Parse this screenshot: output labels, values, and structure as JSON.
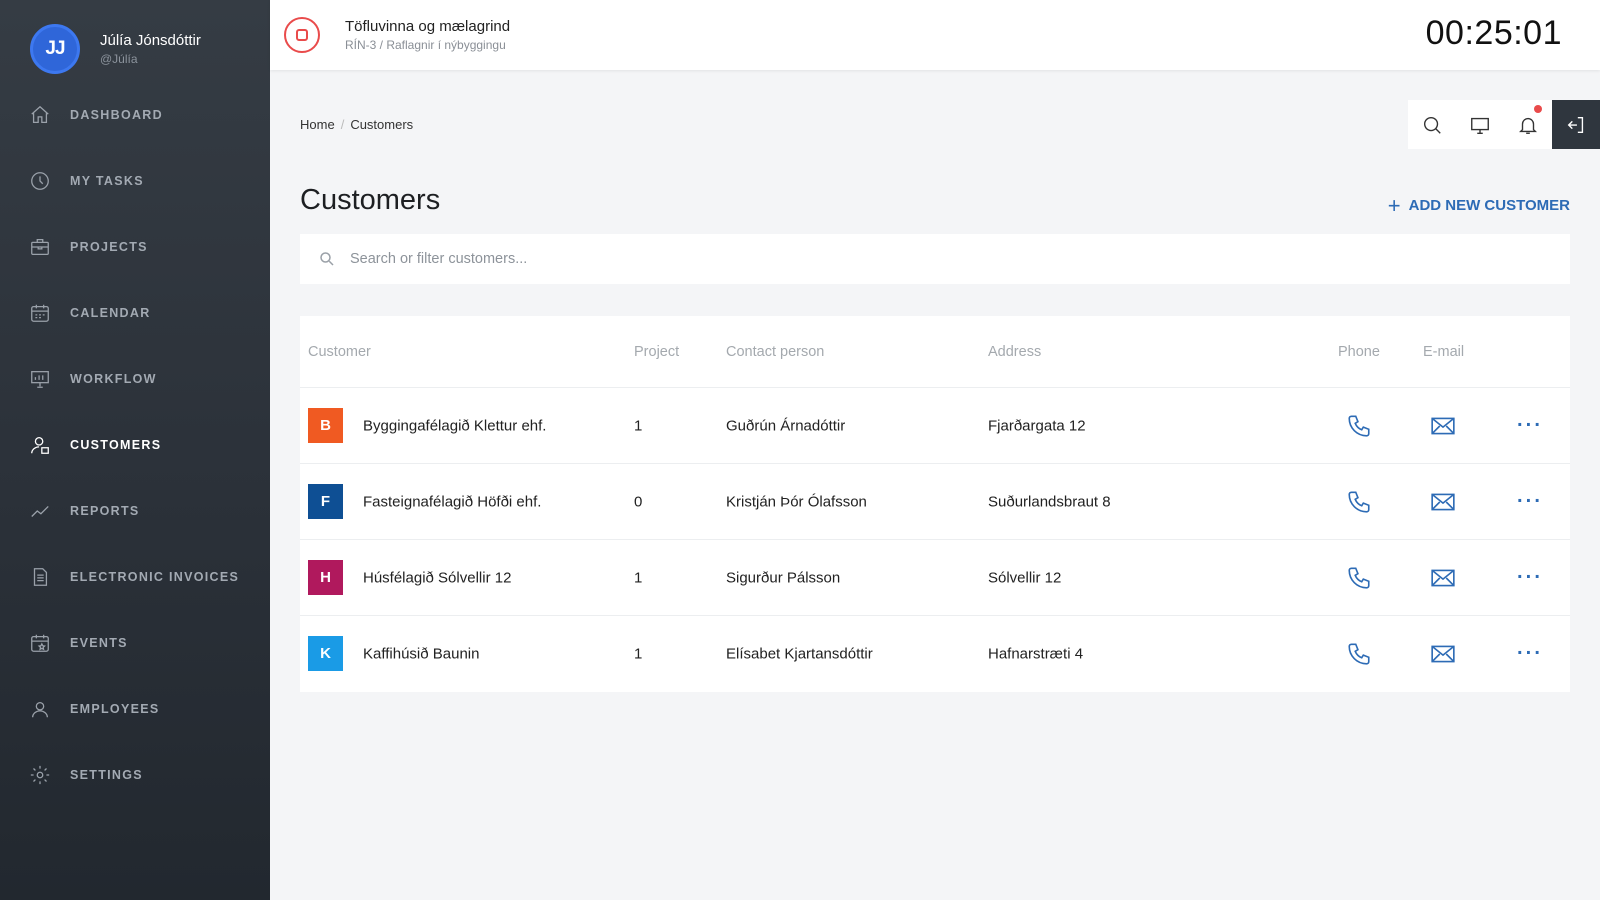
{
  "user": {
    "initials": "JJ",
    "name": "Júlía Jónsdóttir",
    "handle": "@Júlía"
  },
  "nav": [
    {
      "label": "DASHBOARD",
      "icon": "home-icon"
    },
    {
      "label": "MY TASKS",
      "icon": "clock-icon"
    },
    {
      "label": "PROJECTS",
      "icon": "briefcase-icon"
    },
    {
      "label": "CALENDAR",
      "icon": "calendar-icon"
    },
    {
      "label": "WORKFLOW",
      "icon": "presentation-chart-icon"
    },
    {
      "label": "CUSTOMERS",
      "icon": "user-icon",
      "active": true
    },
    {
      "label": "REPORTS",
      "icon": "trend-line-icon"
    },
    {
      "label": "ELECTRONIC INVOICES",
      "icon": "document-icon"
    },
    {
      "label": "EVENTS",
      "icon": "calendar-star-icon"
    },
    {
      "label": "EMPLOYEES",
      "icon": "users-icon"
    },
    {
      "label": "SETTINGS",
      "icon": "gear-icon"
    }
  ],
  "timer": {
    "task_title": "Töfluvinna og mælagrind",
    "task_sub": "RÍN-3 / Raflagnir í nýbyggingu",
    "elapsed": "00:25:01"
  },
  "breadcrumb": {
    "home": "Home",
    "current": "Customers"
  },
  "page": {
    "title": "Customers",
    "add_label": "ADD NEW CUSTOMER",
    "add_icon": "plus-icon"
  },
  "search": {
    "placeholder": "Search or filter customers..."
  },
  "table": {
    "headers": {
      "customer": "Customer",
      "project": "Project",
      "contact": "Contact person",
      "address": "Address",
      "phone": "Phone",
      "email": "E-mail"
    },
    "rows": [
      {
        "initial": "B",
        "color": "#f05a22",
        "name": "Byggingafélagið Klettur ehf.",
        "project": "1",
        "contact": "Guðrún Árnadóttir",
        "address": "Fjarðargata 12"
      },
      {
        "initial": "F",
        "color": "#0e4f94",
        "name": "Fasteignafélagið Höfði ehf.",
        "project": "0",
        "contact": "Kristján Þór Ólafsson",
        "address": "Suðurlandsbraut 8"
      },
      {
        "initial": "H",
        "color": "#b0195d",
        "name": "Húsfélagið Sólvellir 12",
        "project": "1",
        "contact": "Sigurður Pálsson",
        "address": "Sólvellir 12"
      },
      {
        "initial": "K",
        "color": "#1a9be6",
        "name": "Kaffihúsið Baunin",
        "project": "1",
        "contact": "Elísabet Kjartansdóttir",
        "address": "Hafnarstræti 4"
      }
    ]
  }
}
